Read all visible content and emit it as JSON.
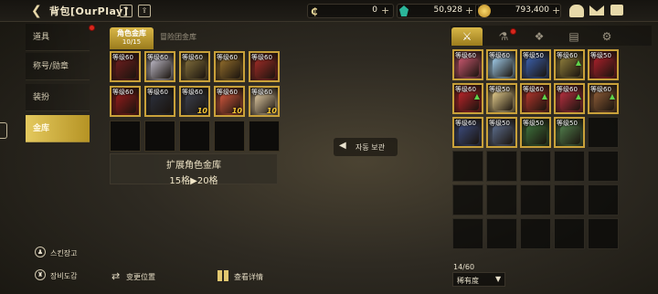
{
  "header": {
    "title": "背包[OurPlay]",
    "back_icon": "arrow-left-icon",
    "help_label": "?",
    "currencies": [
      {
        "icon": "c-coin-icon",
        "value": "0"
      },
      {
        "icon": "green-gem-icon",
        "value": "50,928"
      },
      {
        "icon": "gold-coin-icon",
        "value": "793,400"
      }
    ]
  },
  "left_tabs": [
    {
      "label": "道具"
    },
    {
      "label": "称号/勋章"
    },
    {
      "label": "装扮"
    },
    {
      "label": "金库"
    }
  ],
  "vault_tabs": {
    "character": {
      "label": "角色金库",
      "count": "10/15"
    },
    "adventure": {
      "label": "冒险团金库"
    }
  },
  "vault_items": [
    {
      "level": "等级60",
      "color": "#6a1d1d"
    },
    {
      "level": "等级60",
      "color": "#b9b5c2"
    },
    {
      "level": "等级60",
      "color": "#7e6b3a"
    },
    {
      "level": "等级60",
      "color": "#8e6a2b"
    },
    {
      "level": "等级60",
      "color": "#9b2b26"
    },
    {
      "level": "等级60",
      "color": "#8e1b1b"
    },
    {
      "level": "等级60",
      "color": "#2b2f3a"
    },
    {
      "level": "等级60",
      "color": "#3a3e4a",
      "ten": "10"
    },
    {
      "level": "等级60",
      "color": "#c9543b",
      "ten": "10"
    },
    {
      "level": "等级60",
      "color": "#d7c29c",
      "ten": "10"
    }
  ],
  "expand": {
    "title": "扩展角色金库",
    "detail": "15格▶20格"
  },
  "auto_store": {
    "label": "자동 보관"
  },
  "bottom_left": {
    "menu1": "스킨장고",
    "menu2": "장비도감",
    "swap": "变更位置",
    "view": "查看详情"
  },
  "inv_tabs": [
    {
      "icon": "crossed-swords-icon"
    },
    {
      "icon": "potion-icon"
    },
    {
      "icon": "materials-icon"
    },
    {
      "icon": "cards-icon"
    },
    {
      "icon": "gear-icon"
    }
  ],
  "inv_items": [
    {
      "level": "等级60",
      "color": "#c4566d"
    },
    {
      "level": "等级60",
      "color": "#9ec9e6"
    },
    {
      "level": "等级50",
      "color": "#3a5ea8"
    },
    {
      "level": "等级60",
      "color": "#8a7a3a",
      "star": "▲"
    },
    {
      "level": "等级50",
      "color": "#a6202a"
    },
    {
      "level": "等级60",
      "color": "#b8242a",
      "star": "▲"
    },
    {
      "level": "等级50",
      "color": "#e0c98a"
    },
    {
      "level": "等级60",
      "color": "#b0352c",
      "star": "▲"
    },
    {
      "level": "等级60",
      "color": "#b53040",
      "star": "▲"
    },
    {
      "level": "等级60",
      "color": "#8a5a36",
      "star": "▲"
    },
    {
      "level": "等级60",
      "color": "#3b4a7a"
    },
    {
      "level": "等级50",
      "color": "#5a6a88"
    },
    {
      "level": "等级50",
      "color": "#3c6e3a"
    },
    {
      "level": "等级50",
      "color": "#4f7a4a"
    }
  ],
  "inv_count": "14/60",
  "sort": {
    "label": "稀有度"
  }
}
